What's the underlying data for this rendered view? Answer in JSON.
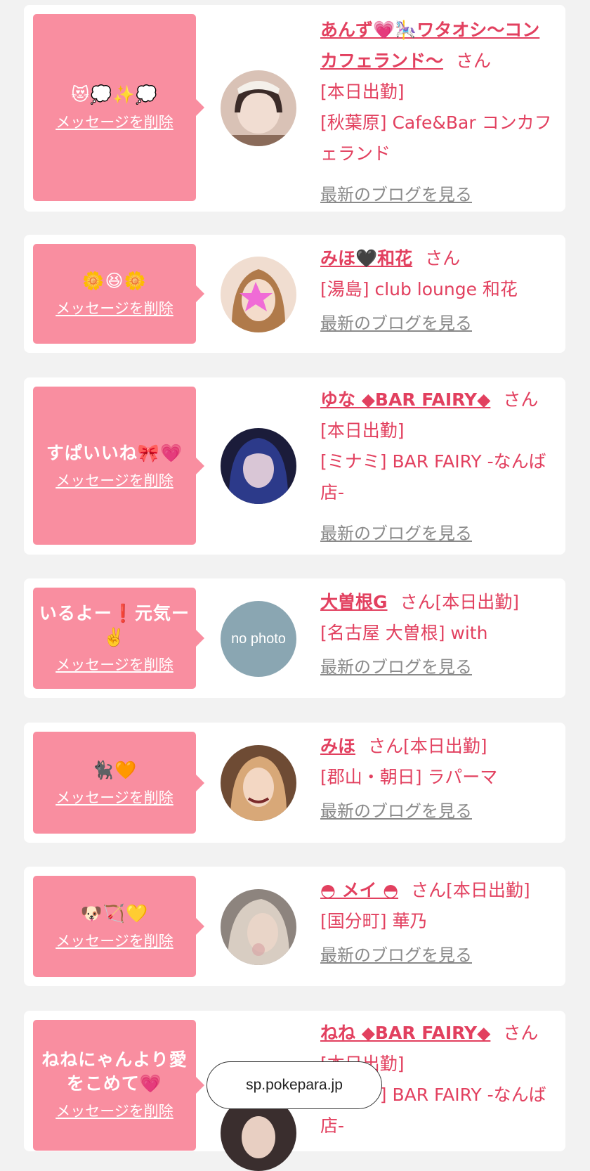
{
  "messages": [
    {
      "message": "😻💭✨💭",
      "delete_label": "メッセージを削除",
      "name": "あんず💗🎠ワタオシ〜コンカフェランド〜",
      "suffix": "さん",
      "status": "[本日出勤]",
      "shop": "[秋葉原] Cafe&Bar コンカフェランド",
      "blog_label": "最新のブログを見る",
      "avatar_color": "#d9c2b6"
    },
    {
      "message": "🌼😆🌼",
      "delete_label": "メッセージを削除",
      "name": "みほ🖤和花",
      "suffix": "さん",
      "status": "",
      "shop": "[湯島] club lounge 和花",
      "blog_label": "最新のブログを見る",
      "avatar_color": "#f0ddd0"
    },
    {
      "message": "すぱいいね🎀💗",
      "delete_label": "メッセージを削除",
      "name": "ゆな ◆BAR FAIRY◆",
      "suffix": "さん",
      "status": "[本日出勤]",
      "shop": "[ミナミ] BAR FAIRY -なんば店-",
      "blog_label": "最新のブログを見る",
      "avatar_color": "#2a2c55"
    },
    {
      "message": "いるよー❗元気ー✌️",
      "delete_label": "メッセージを削除",
      "name": "大曽根G",
      "suffix": "さん",
      "status": "[本日出勤]",
      "shop": "[名古屋 大曽根] with",
      "blog_label": "最新のブログを見る",
      "avatar_color": "#8aa6b2",
      "avatar_text": "no photo"
    },
    {
      "message": "🐈‍⬛🧡",
      "delete_label": "メッセージを削除",
      "name": "みほ",
      "suffix": "さん",
      "status": "[本日出勤]",
      "shop": "[郡山・朝日] ラパーマ",
      "blog_label": "最新のブログを見る",
      "avatar_color": "#6e4b34"
    },
    {
      "message": "🐶🏹💛",
      "delete_label": "メッセージを削除",
      "name": "◓ メイ ◓",
      "suffix": "さん",
      "status": "[本日出勤]",
      "shop": "[国分町] 華乃",
      "blog_label": "最新のブログを見る",
      "avatar_color": "#b9aea6"
    },
    {
      "message": "ねねにゃんより愛をこめて💗",
      "delete_label": "メッセージを削除",
      "name": "ねね ◆BAR FAIRY◆",
      "suffix": "さん",
      "status": "[本日出勤]",
      "shop": "[ミナミ] BAR FAIRY -なんば店-",
      "blog_label": "",
      "avatar_color": "#3a2e2e"
    }
  ],
  "browser": {
    "url": "sp.pokepara.jp"
  }
}
